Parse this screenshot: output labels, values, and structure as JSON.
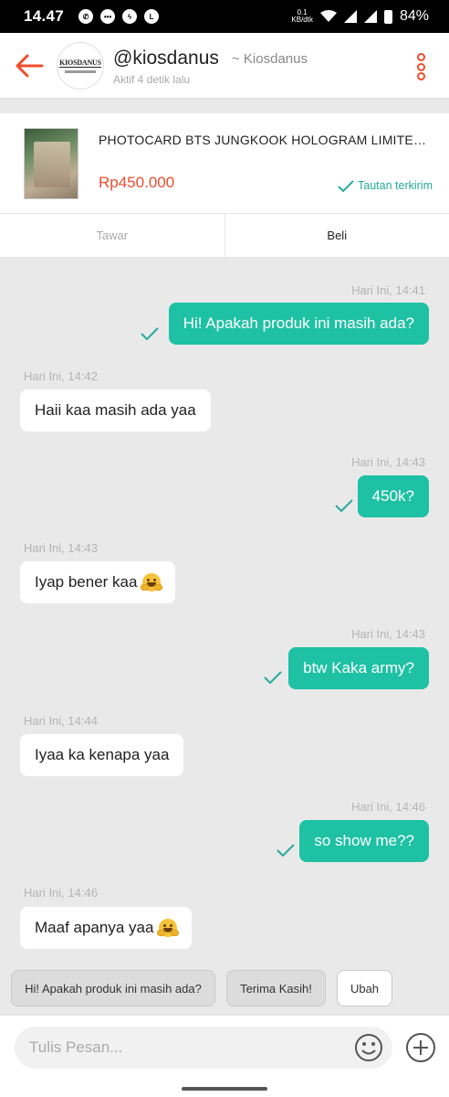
{
  "status_bar": {
    "time": "14.47",
    "speed_value": "0.1",
    "speed_unit": "KB/dtk",
    "battery": "84%",
    "app_icons": [
      "whatsapp-icon",
      "chat-bubble-icon",
      "messenger-icon",
      "line-icon"
    ]
  },
  "header": {
    "name": "@kiosdanus",
    "alias": "~ Kiosdanus",
    "status": "Aktif 4 detik lalu",
    "avatar_text": "KIOSDANUS"
  },
  "product": {
    "title": "PHOTOCARD BTS JUNGKOOK HOLOGRAM LIMITED...",
    "price": "Rp450.000",
    "sent_label": "Tautan terkirim"
  },
  "actions": {
    "tawar": "Tawar",
    "beli": "Beli"
  },
  "messages": [
    {
      "from": "me",
      "time": "Hari Ini, 14:41",
      "text": "Hi! Apakah produk ini masih ada?"
    },
    {
      "from": "them",
      "time": "Hari Ini, 14:42",
      "text": "Haii kaa masih ada yaa"
    },
    {
      "from": "me",
      "time": "Hari Ini, 14:43",
      "text": "450k?"
    },
    {
      "from": "them",
      "time": "Hari Ini, 14:43",
      "text": "Iyap bener kaa",
      "emoji": "hugging-face-emoji"
    },
    {
      "from": "me",
      "time": "Hari Ini, 14:43",
      "text": "btw Kaka army?"
    },
    {
      "from": "them",
      "time": "Hari Ini, 14:44",
      "text": "Iyaa ka kenapa yaa"
    },
    {
      "from": "me",
      "time": "Hari Ini, 14:46",
      "text": "so show me??"
    },
    {
      "from": "them",
      "time": "Hari Ini, 14:46",
      "text": "Maaf apanya yaa",
      "emoji": "hugging-face-emoji"
    }
  ],
  "quick_replies": [
    "Hi! Apakah produk ini masih ada?",
    "Terima Kasih!",
    "Ubah"
  ],
  "input": {
    "placeholder": "Tulis Pesan..."
  },
  "colors": {
    "accent": "#ee4d2d",
    "sent_bubble": "#1fc1a4",
    "check": "#26aa99",
    "chat_bg": "#e9e9e9"
  }
}
